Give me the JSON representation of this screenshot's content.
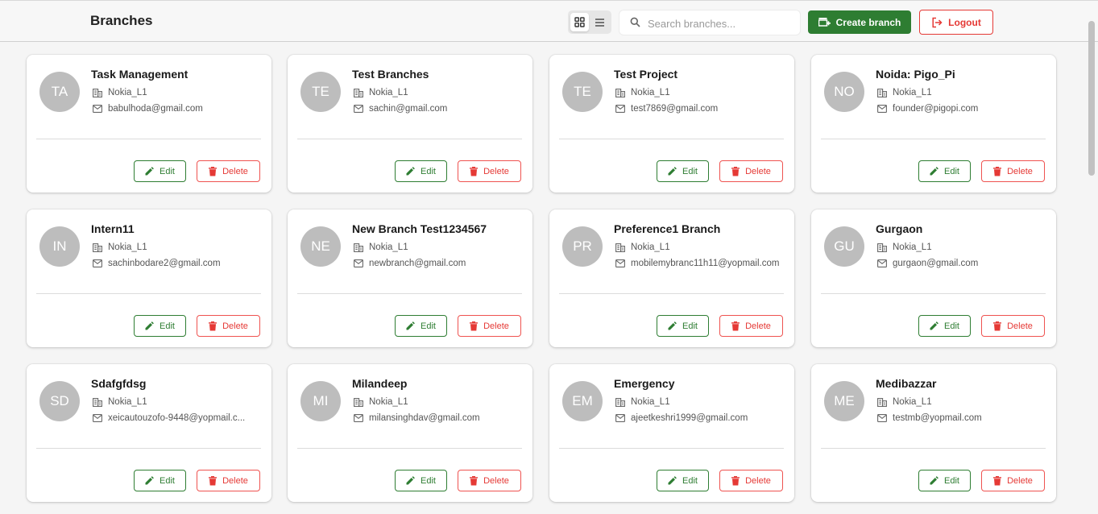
{
  "header": {
    "title": "Branches",
    "search_placeholder": "Search branches...",
    "create_label": "Create branch",
    "logout_label": "Logout"
  },
  "view_mode": "grid",
  "buttons": {
    "edit": "Edit",
    "delete": "Delete"
  },
  "branches": [
    {
      "initials": "TA",
      "name": "Task Management",
      "org": "Nokia_L1",
      "email": "babulhoda@gmail.com"
    },
    {
      "initials": "TE",
      "name": "Test Branches",
      "org": "Nokia_L1",
      "email": "sachin@gmail.com"
    },
    {
      "initials": "TE",
      "name": "Test Project",
      "org": "Nokia_L1",
      "email": "test7869@gmail.com"
    },
    {
      "initials": "NO",
      "name": "Noida: Pigo_Pi",
      "org": "Nokia_L1",
      "email": "founder@pigopi.com"
    },
    {
      "initials": "IN",
      "name": "Intern11",
      "org": "Nokia_L1",
      "email": "sachinbodare2@gmail.com"
    },
    {
      "initials": "NE",
      "name": "New Branch Test1234567",
      "org": "Nokia_L1",
      "email": "newbranch@gmail.com"
    },
    {
      "initials": "PR",
      "name": "Preference1 Branch",
      "org": "Nokia_L1",
      "email": "mobilemybranc11h11@yopmail.com"
    },
    {
      "initials": "GU",
      "name": "Gurgaon",
      "org": "Nokia_L1",
      "email": "gurgaon@gmail.com"
    },
    {
      "initials": "SD",
      "name": "Sdafgfdsg",
      "org": "Nokia_L1",
      "email": "xeicautouzofo-9448@yopmail.c..."
    },
    {
      "initials": "MI",
      "name": "Milandeep",
      "org": "Nokia_L1",
      "email": "milansinghdav@gmail.com"
    },
    {
      "initials": "EM",
      "name": "Emergency",
      "org": "Nokia_L1",
      "email": "ajeetkeshri1999@gmail.com"
    },
    {
      "initials": "ME",
      "name": "Medibazzar",
      "org": "Nokia_L1",
      "email": "testmb@yopmail.com"
    }
  ],
  "colors": {
    "primary_green": "#2e7d32",
    "danger_red": "#e53935",
    "avatar_gray": "#bdbdbd"
  }
}
